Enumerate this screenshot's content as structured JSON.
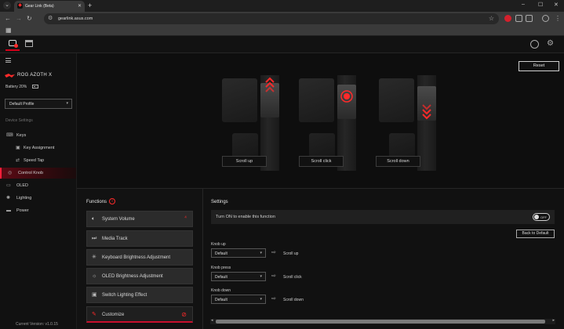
{
  "browser": {
    "tab_title": "Gear Link (Beta)",
    "url": "gearlink.asus.com"
  },
  "sidebar": {
    "device_name": "ROG AZOTH X",
    "battery": "Battery 20%",
    "profile": "Default Profile",
    "settings_heading": "Device Settings",
    "items": [
      {
        "label": "Keys"
      },
      {
        "label": "Key Assignment"
      },
      {
        "label": "Speed Tap"
      },
      {
        "label": "Control Knob"
      },
      {
        "label": "OLED"
      },
      {
        "label": "Lighting"
      },
      {
        "label": "Power"
      }
    ],
    "version": "Current Version: v1.0.15"
  },
  "stage": {
    "reset_label": "Reset",
    "knobs": [
      {
        "label": "Scroll up"
      },
      {
        "label": "Scroll click"
      },
      {
        "label": "Scroll down"
      }
    ]
  },
  "functions": {
    "title": "Functions",
    "items": [
      {
        "label": "System Volume",
        "icon": "speaker-icon"
      },
      {
        "label": "Media Track",
        "icon": "media-track-icon"
      },
      {
        "label": "Keyboard Brightness Adjustment",
        "icon": "sun-icon"
      },
      {
        "label": "OLED Brightness Adjustment",
        "icon": "sun-icon"
      },
      {
        "label": "Switch Lighting Effect",
        "icon": "lighting-icon"
      },
      {
        "label": "Customize",
        "icon": "edit-icon"
      }
    ]
  },
  "settings": {
    "title": "Settings",
    "enable_label": "Turn ON to enable this function",
    "toggle_text": "OFF",
    "back_default": "Back to Default",
    "rows": [
      {
        "label": "Knob up",
        "value": "Default",
        "action": "Scroll up"
      },
      {
        "label": "Knob press",
        "value": "Default",
        "action": "Scroll click"
      },
      {
        "label": "Knob down",
        "value": "Default",
        "action": "Scroll down"
      }
    ]
  },
  "colors": {
    "accent": "#ff2a2a",
    "active_nav": "#5a0a14",
    "background": "#0b0b0b"
  }
}
